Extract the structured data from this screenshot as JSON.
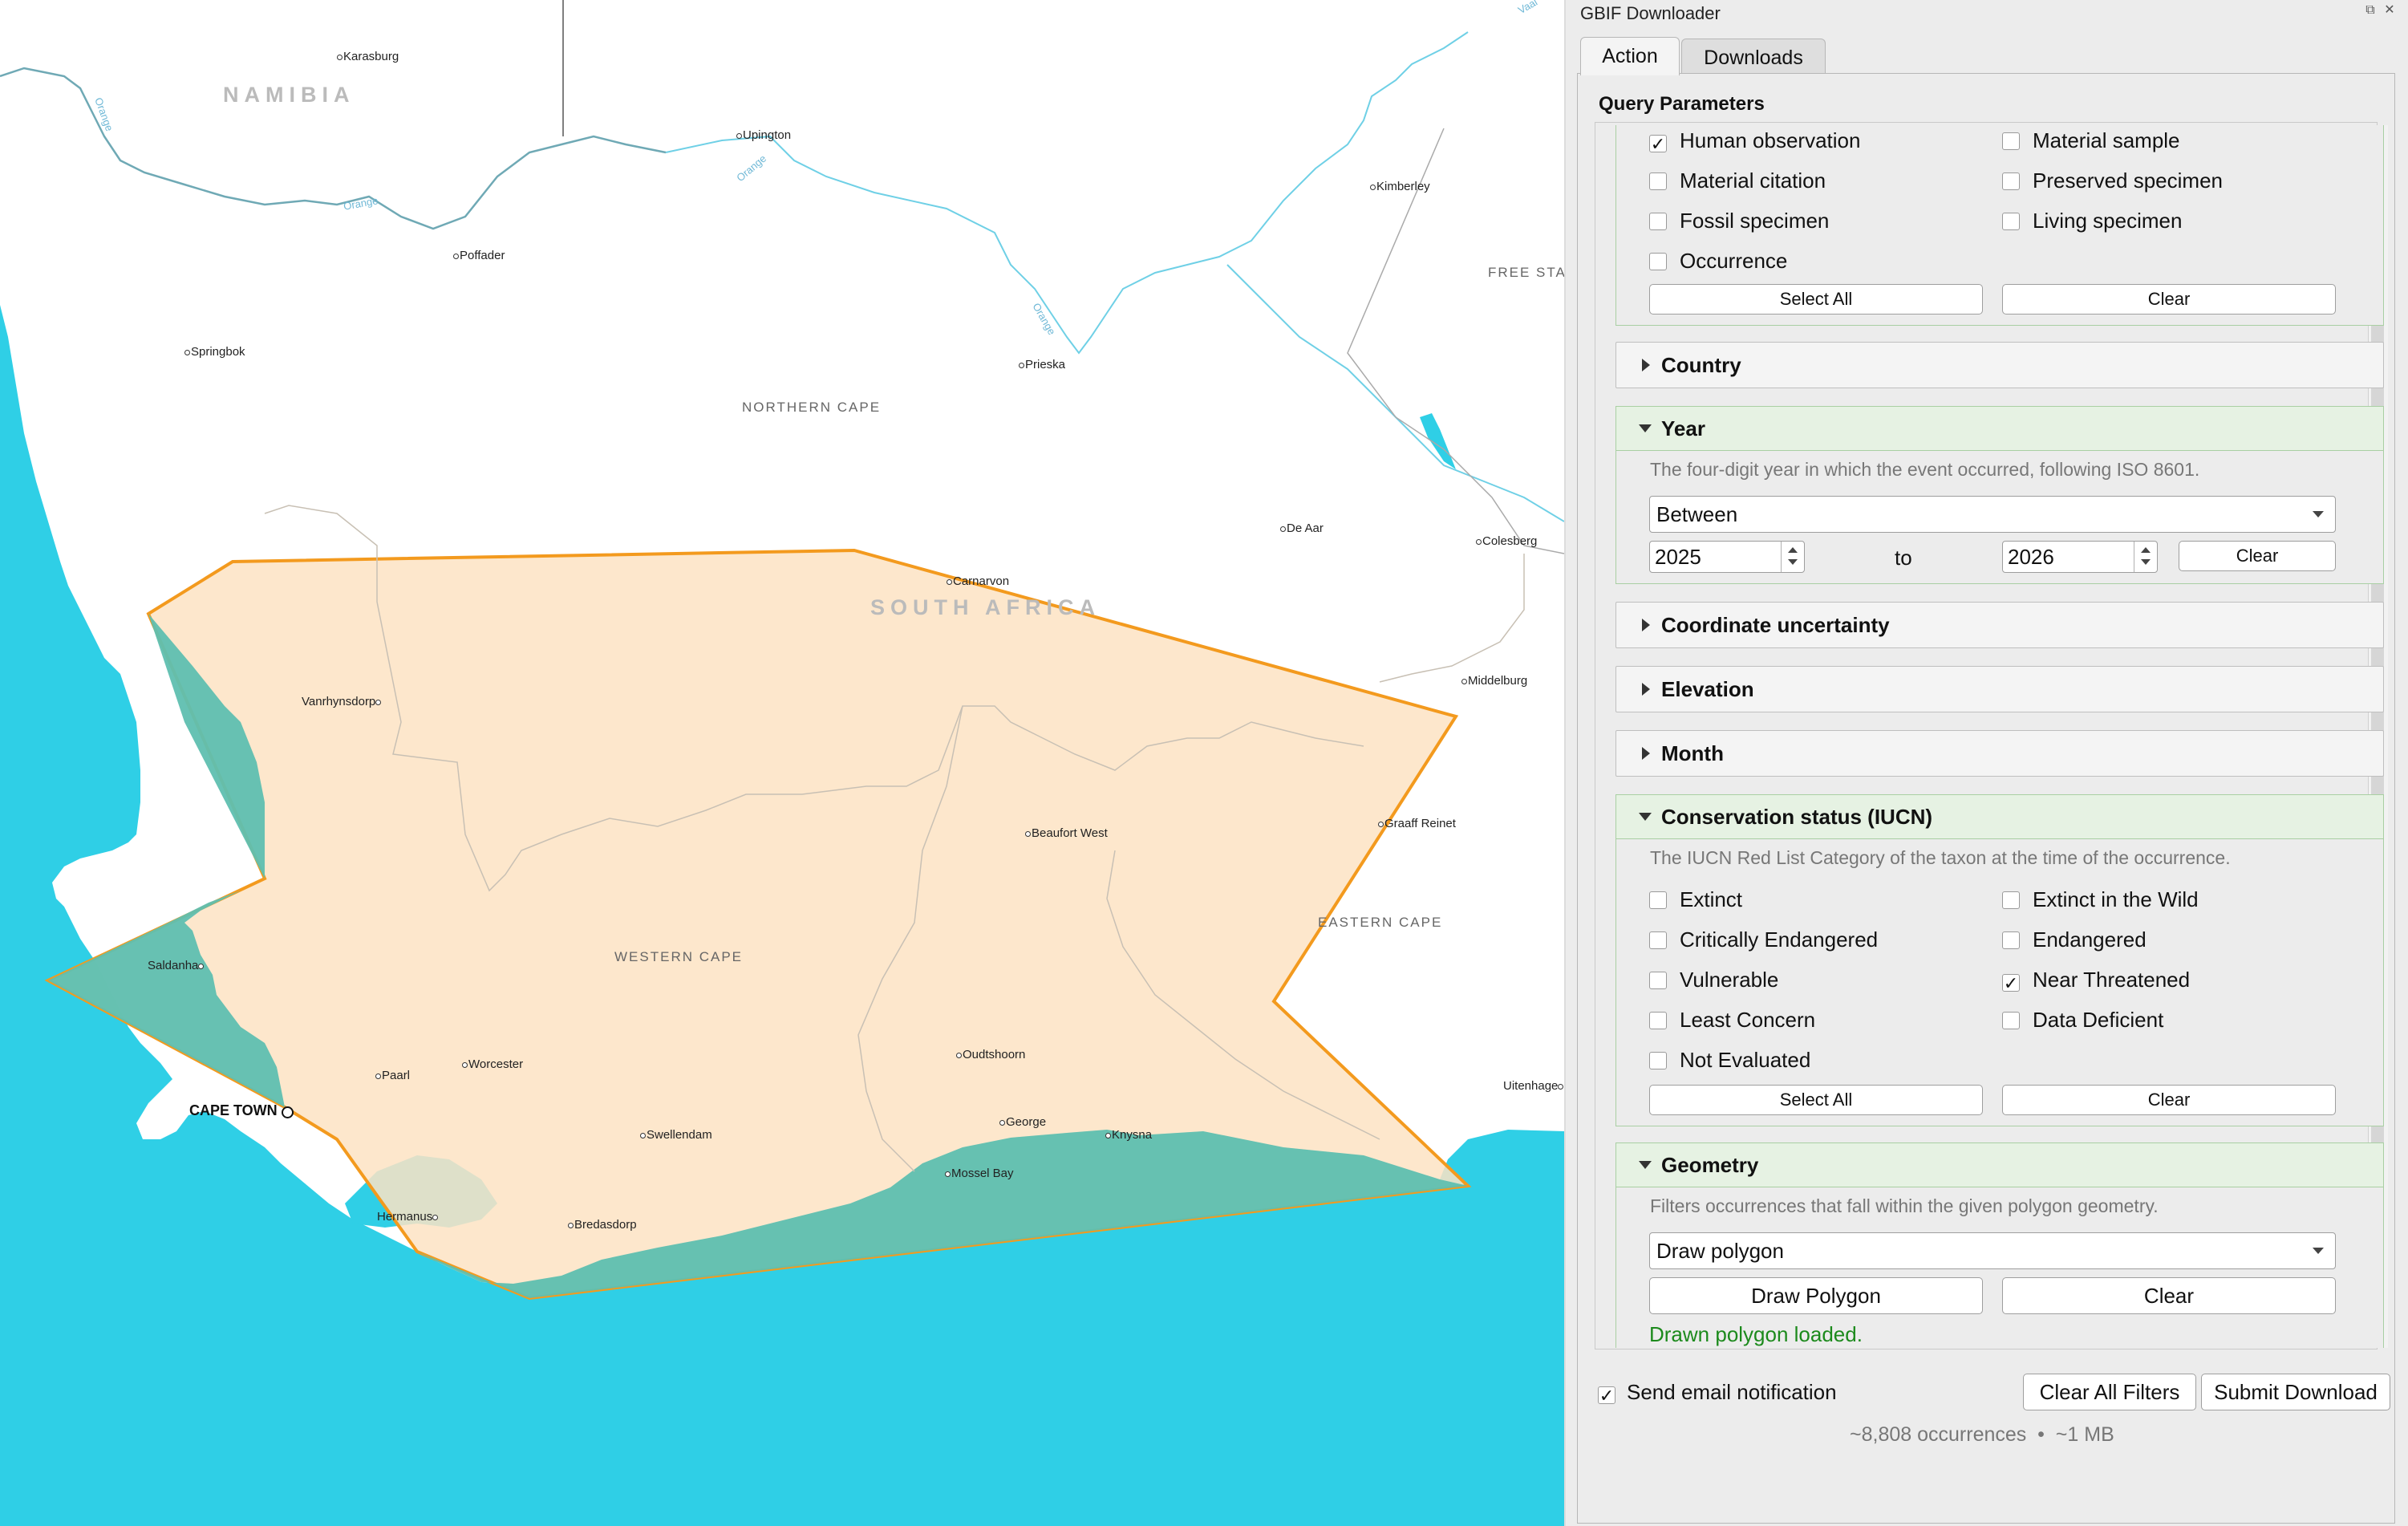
{
  "map": {
    "country_labels": [
      "NAMIBIA",
      "SOUTH AFRICA"
    ],
    "region_labels": [
      "NORTHERN CAPE",
      "WESTERN CAPE",
      "EASTERN CAPE",
      "FREE STA"
    ],
    "river_labels": [
      "Orange",
      "Orange",
      "Orange",
      "Orange",
      "Vaal"
    ],
    "places": [
      "Karasburg",
      "Upington",
      "Kimberley",
      "Poffader",
      "Springbok",
      "Prieska",
      "De Aar",
      "Colesberg",
      "Carnarvon",
      "Middelburg",
      "Vanrhynsdorp",
      "Beaufort West",
      "Graaff Reinet",
      "Saldanha",
      "Worcester",
      "Paarl",
      "Oudtshoorn",
      "George",
      "Knysna",
      "Swellendam",
      "Mossel Bay",
      "Hermanus",
      "Bredasdorp",
      "Uitenhage"
    ],
    "capital": "CAPE TOWN",
    "colors": {
      "sea": "#2fcfe6",
      "land": "#ffffff",
      "polygon_fill": "#fde3c3",
      "polygon_stroke": "#f39a1e",
      "overlap": "#5fbfb0",
      "river": "#6fd0e6"
    }
  },
  "panel": {
    "title": "GBIF Downloader",
    "window_icons": [
      "restore-icon",
      "close-icon"
    ],
    "tabs": [
      {
        "label": "Action"
      },
      {
        "label": "Downloads"
      }
    ],
    "query_parameters_label": "Query Parameters",
    "basis": {
      "options": [
        {
          "label": "Human observation",
          "checked": true
        },
        {
          "label": "Material sample",
          "checked": false
        },
        {
          "label": "Material citation",
          "checked": false
        },
        {
          "label": "Preserved specimen",
          "checked": false
        },
        {
          "label": "Fossil specimen",
          "checked": false
        },
        {
          "label": "Living specimen",
          "checked": false
        },
        {
          "label": "Occurrence",
          "checked": false
        }
      ],
      "select_all": "Select All",
      "clear": "Clear"
    },
    "country": {
      "label": "Country"
    },
    "year": {
      "label": "Year",
      "description": "The four-digit year in which the event occurred, following ISO 8601.",
      "mode": "Between",
      "from": "2025",
      "to_label": "to",
      "to": "2026",
      "clear": "Clear"
    },
    "coordinate_uncertainty": {
      "label": "Coordinate uncertainty"
    },
    "elevation": {
      "label": "Elevation"
    },
    "month": {
      "label": "Month"
    },
    "conservation": {
      "label": "Conservation status (IUCN)",
      "description": "The IUCN Red List Category of the taxon at the time of the occurrence.",
      "options": [
        {
          "label": "Extinct",
          "checked": false
        },
        {
          "label": "Extinct in the Wild",
          "checked": false
        },
        {
          "label": "Critically Endangered",
          "checked": false
        },
        {
          "label": "Endangered",
          "checked": false
        },
        {
          "label": "Vulnerable",
          "checked": false
        },
        {
          "label": "Near Threatened",
          "checked": true
        },
        {
          "label": "Least Concern",
          "checked": false
        },
        {
          "label": "Data Deficient",
          "checked": false
        },
        {
          "label": "Not Evaluated",
          "checked": false
        }
      ],
      "select_all": "Select All",
      "clear": "Clear"
    },
    "geometry": {
      "label": "Geometry",
      "description": "Filters occurrences that fall within the given polygon geometry.",
      "mode": "Draw polygon",
      "draw": "Draw Polygon",
      "clear": "Clear",
      "status": "Drawn polygon loaded."
    },
    "footer": {
      "email_label": "Send email notification",
      "email_checked": true,
      "clear_all": "Clear All Filters",
      "submit": "Submit Download",
      "summary": "~8,808 occurrences  •  ~1 MB"
    }
  }
}
